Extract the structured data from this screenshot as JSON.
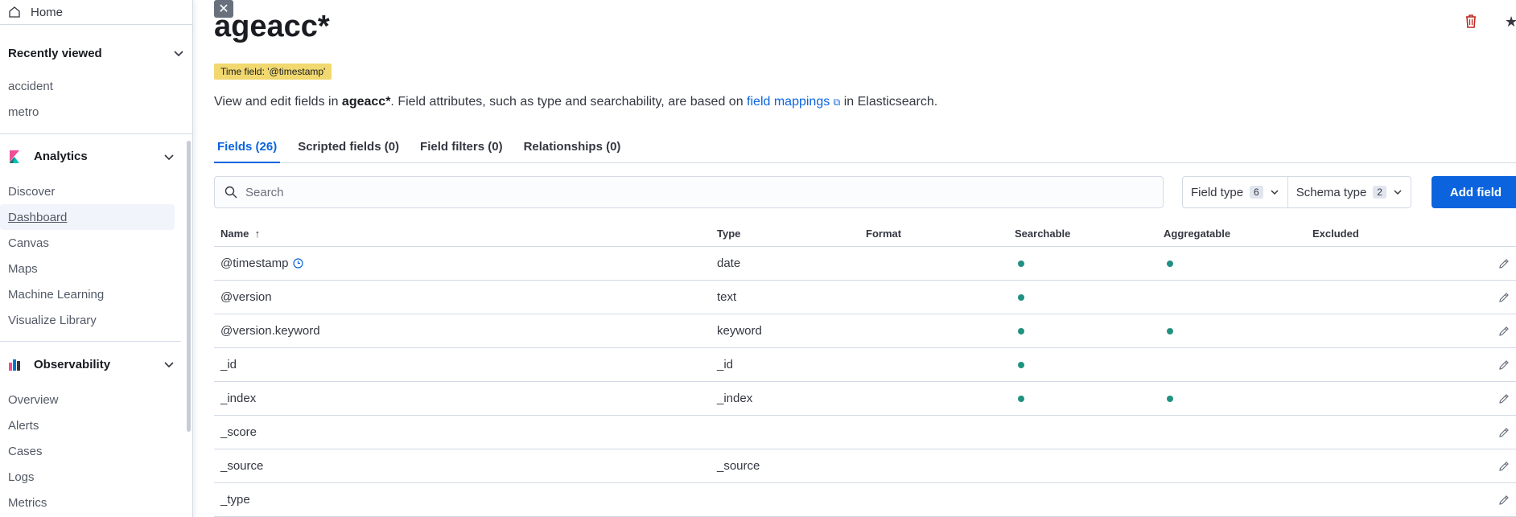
{
  "sidebar": {
    "home": "Home",
    "recent": {
      "title": "Recently viewed",
      "items": [
        "accident",
        "metro"
      ]
    },
    "analytics": {
      "title": "Analytics",
      "items": [
        "Discover",
        "Dashboard",
        "Canvas",
        "Maps",
        "Machine Learning",
        "Visualize Library"
      ],
      "active": "Dashboard"
    },
    "observability": {
      "title": "Observability",
      "items": [
        "Overview",
        "Alerts",
        "Cases",
        "Logs",
        "Metrics"
      ]
    }
  },
  "page": {
    "title": "ageacc*",
    "time_badge": "Time field: '@timestamp'",
    "desc_prefix": "View and edit fields in ",
    "desc_pattern": "ageacc*",
    "desc_mid": ". Field attributes, such as type and searchability, are based on ",
    "desc_link": "field mappings",
    "desc_suffix": " in Elasticsearch."
  },
  "tabs": [
    "Fields (26)",
    "Scripted fields (0)",
    "Field filters (0)",
    "Relationships (0)"
  ],
  "search": {
    "placeholder": "Search"
  },
  "filters": [
    {
      "label": "Field type",
      "count": "6"
    },
    {
      "label": "Schema type",
      "count": "2"
    }
  ],
  "add_field": "Add field",
  "table": {
    "headers": {
      "name": "Name",
      "type": "Type",
      "format": "Format",
      "searchable": "Searchable",
      "aggregatable": "Aggregatable",
      "excluded": "Excluded"
    },
    "rows": [
      {
        "name": "@timestamp",
        "type": "date",
        "searchable": true,
        "aggregatable": true,
        "time": true
      },
      {
        "name": "@version",
        "type": "text",
        "searchable": true,
        "aggregatable": false
      },
      {
        "name": "@version.keyword",
        "type": "keyword",
        "searchable": true,
        "aggregatable": true
      },
      {
        "name": "_id",
        "type": "_id",
        "searchable": true,
        "aggregatable": false
      },
      {
        "name": "_index",
        "type": "_index",
        "searchable": true,
        "aggregatable": true
      },
      {
        "name": "_score",
        "type": "",
        "searchable": false,
        "aggregatable": false
      },
      {
        "name": "_source",
        "type": "_source",
        "searchable": false,
        "aggregatable": false
      },
      {
        "name": "_type",
        "type": "",
        "searchable": false,
        "aggregatable": false
      }
    ]
  },
  "colors": {
    "accent": "#0b64dd",
    "badge": "#f1d86f",
    "dot": "#209280"
  }
}
